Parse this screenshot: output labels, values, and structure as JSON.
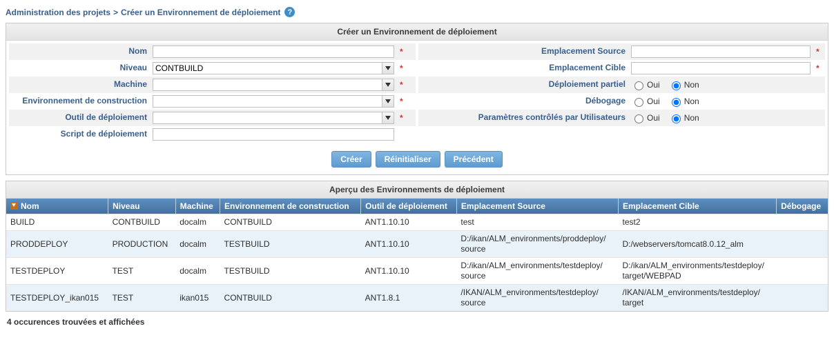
{
  "breadcrumb": {
    "admin": "Administration des projets",
    "sep": ">",
    "current": "Créer un Environnement de déploiement"
  },
  "panel": {
    "title": "Créer un Environnement de déploiement"
  },
  "form": {
    "left": {
      "nom": {
        "label": "Nom",
        "value": ""
      },
      "niveau": {
        "label": "Niveau",
        "value": "CONTBUILD"
      },
      "machine": {
        "label": "Machine",
        "value": ""
      },
      "env_constr": {
        "label": "Environnement de construction",
        "value": ""
      },
      "outil": {
        "label": "Outil de déploiement",
        "value": ""
      },
      "script": {
        "label": "Script de déploiement",
        "value": ""
      }
    },
    "right": {
      "source": {
        "label": "Emplacement Source",
        "value": ""
      },
      "cible": {
        "label": "Emplacement Cible",
        "value": ""
      },
      "partiel": {
        "label": "Déploiement partiel",
        "oui": "Oui",
        "non": "Non"
      },
      "debug": {
        "label": "Débogage",
        "oui": "Oui",
        "non": "Non"
      },
      "params": {
        "label": "Paramètres contrôlés par Utilisateurs",
        "oui": "Oui",
        "non": "Non"
      }
    },
    "buttons": {
      "create": "Créer",
      "reset": "Réinitialiser",
      "back": "Précédent"
    }
  },
  "overview": {
    "title": "Aperçu des Environnements de déploiement",
    "columns": {
      "nom": "Nom",
      "niveau": "Niveau",
      "machine": "Machine",
      "env_constr": "Environnement de construction",
      "outil": "Outil de déploiement",
      "source": "Emplacement Source",
      "cible": "Emplacement Cible",
      "debug": "Débogage"
    },
    "rows": [
      {
        "nom": "BUILD",
        "niveau": "CONTBUILD",
        "machine": "docalm",
        "env_constr": "CONTBUILD",
        "outil": "ANT1.10.10",
        "source": "test",
        "cible": "test2",
        "debug": ""
      },
      {
        "nom": "PRODDEPLOY",
        "niveau": "PRODUCTION",
        "machine": "docalm",
        "env_constr": "TESTBUILD",
        "outil": "ANT1.10.10",
        "source": "D:/ikan/ALM_environments/proddeploy/\nsource",
        "cible": "D:/webservers/tomcat8.0.12_alm",
        "debug": ""
      },
      {
        "nom": "TESTDEPLOY",
        "niveau": "TEST",
        "machine": "docalm",
        "env_constr": "TESTBUILD",
        "outil": "ANT1.10.10",
        "source": "D:/ikan/ALM_environments/testdeploy/\nsource",
        "cible": "D:/ikan/ALM_environments/testdeploy/\ntarget/WEBPAD",
        "debug": ""
      },
      {
        "nom": "TESTDEPLOY_ikan015",
        "niveau": "TEST",
        "machine": "ikan015",
        "env_constr": "CONTBUILD",
        "outil": "ANT1.8.1",
        "source": "/IKAN/ALM_environments/testdeploy/\nsource",
        "cible": "/IKAN/ALM_environments/testdeploy/\ntarget",
        "debug": ""
      }
    ],
    "status": "4 occurences trouvées et affichées"
  }
}
